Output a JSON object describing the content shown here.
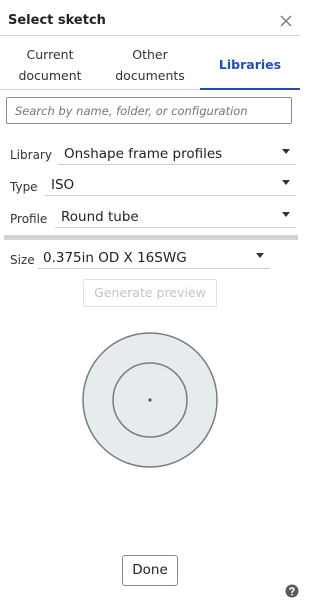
{
  "dialog": {
    "title": "Select sketch"
  },
  "tabs": [
    {
      "line1": "Current",
      "line2": "document"
    },
    {
      "line1": "Other",
      "line2": "documents"
    },
    {
      "label": "Libraries"
    }
  ],
  "search": {
    "placeholder": "Search by name, folder, or configuration",
    "value": ""
  },
  "filters": {
    "library": {
      "label": "Library",
      "value": "Onshape frame profiles"
    },
    "type": {
      "label": "Type",
      "value": "ISO"
    },
    "profile": {
      "label": "Profile",
      "value": "Round tube"
    }
  },
  "size": {
    "label": "Size",
    "value": "0.375in OD X 16SWG"
  },
  "preview": {
    "button_label": "Generate preview"
  },
  "footer": {
    "done_label": "Done"
  },
  "icons": {
    "close": "close-icon",
    "help": "help-icon",
    "dropdown": "chevron-down-icon"
  },
  "colors": {
    "accent": "#1f4fb5",
    "preview_fill": "#e6ecee",
    "preview_stroke": "#7b7b7b"
  }
}
